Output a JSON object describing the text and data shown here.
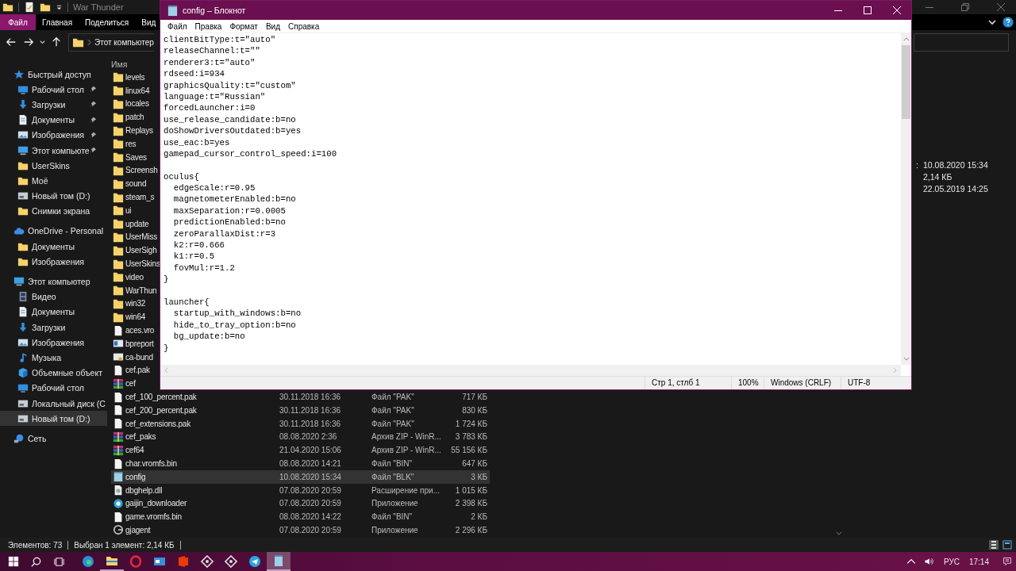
{
  "explorer": {
    "title": "War Thunder",
    "ribbon": [
      {
        "label": "Файл",
        "kind": "menu"
      },
      {
        "label": "Главная",
        "kind": "tab"
      },
      {
        "label": "Поделиться",
        "kind": "tab"
      },
      {
        "label": "Вид",
        "kind": "tab"
      }
    ],
    "address": {
      "crumbs": [
        "Этот компьютер"
      ]
    },
    "nav": [
      {
        "label": "Быстрый доступ",
        "kind": "star",
        "pinned": false,
        "selected": false,
        "children": [
          {
            "label": "Рабочий стол",
            "kind": "desktop",
            "pinned": true,
            "selected": false
          },
          {
            "label": "Загрузки",
            "kind": "download",
            "pinned": true,
            "selected": false
          },
          {
            "label": "Документы",
            "kind": "document",
            "pinned": true,
            "selected": false
          },
          {
            "label": "Изображения",
            "kind": "pictures",
            "pinned": true,
            "selected": false
          },
          {
            "label": "Этот компьюте",
            "kind": "computer",
            "pinned": true,
            "selected": false
          },
          {
            "label": "UserSkins",
            "kind": "folder",
            "pinned": false,
            "selected": false
          },
          {
            "label": "Моё",
            "kind": "folder",
            "pinned": false,
            "selected": false
          },
          {
            "label": "Новый том (D:)",
            "kind": "drive",
            "pinned": false,
            "selected": false
          },
          {
            "label": "Снимки экрана",
            "kind": "folder",
            "pinned": false,
            "selected": false
          }
        ]
      },
      {
        "label": "OneDrive - Personal",
        "kind": "cloud",
        "pinned": false,
        "selected": false,
        "children": [
          {
            "label": "Документы",
            "kind": "folder",
            "pinned": false,
            "selected": false
          },
          {
            "label": "Изображения",
            "kind": "folder",
            "pinned": false,
            "selected": false
          }
        ]
      },
      {
        "label": "Этот компьютер",
        "kind": "computer",
        "pinned": false,
        "selected": false,
        "children": [
          {
            "label": "Видео",
            "kind": "video",
            "pinned": false,
            "selected": false
          },
          {
            "label": "Документы",
            "kind": "document",
            "pinned": false,
            "selected": false
          },
          {
            "label": "Загрузки",
            "kind": "download",
            "pinned": false,
            "selected": false
          },
          {
            "label": "Изображения",
            "kind": "pictures",
            "pinned": false,
            "selected": false
          },
          {
            "label": "Музыка",
            "kind": "music",
            "pinned": false,
            "selected": false
          },
          {
            "label": "Объемные объект",
            "kind": "cube",
            "pinned": false,
            "selected": false
          },
          {
            "label": "Рабочий стол",
            "kind": "desktop",
            "pinned": false,
            "selected": false
          },
          {
            "label": "Локальный диск (С",
            "kind": "drive",
            "pinned": false,
            "selected": false
          },
          {
            "label": "Новый том (D:)",
            "kind": "drive",
            "pinned": false,
            "selected": true
          }
        ]
      },
      {
        "label": "Сеть",
        "kind": "network",
        "pinned": false,
        "selected": false
      }
    ],
    "file_list": {
      "column": "Имя",
      "rows": [
        {
          "name": "levels",
          "kind": "folder",
          "selected": false
        },
        {
          "name": "linux64",
          "kind": "folder",
          "selected": false
        },
        {
          "name": "locales",
          "kind": "folder",
          "selected": false
        },
        {
          "name": "patch",
          "kind": "folder",
          "selected": false
        },
        {
          "name": "Replays",
          "kind": "folder",
          "selected": false
        },
        {
          "name": "res",
          "kind": "folder",
          "selected": false
        },
        {
          "name": "Saves",
          "kind": "folder",
          "selected": false
        },
        {
          "name": "Screensh",
          "kind": "folder",
          "selected": false
        },
        {
          "name": "sound",
          "kind": "folder",
          "selected": false
        },
        {
          "name": "steam_s",
          "kind": "folder",
          "selected": false
        },
        {
          "name": "ui",
          "kind": "folder",
          "selected": false
        },
        {
          "name": "update",
          "kind": "folder",
          "selected": false
        },
        {
          "name": "UserMiss",
          "kind": "folder",
          "selected": false
        },
        {
          "name": "UserSigh",
          "kind": "folder",
          "selected": false
        },
        {
          "name": "UserSkins",
          "kind": "folder",
          "selected": false
        },
        {
          "name": "video",
          "kind": "folder",
          "selected": false
        },
        {
          "name": "WarThun",
          "kind": "folder",
          "selected": false
        },
        {
          "name": "win32",
          "kind": "folder",
          "selected": false
        },
        {
          "name": "win64",
          "kind": "folder",
          "selected": false
        },
        {
          "name": "aces.vro",
          "kind": "file",
          "selected": false
        },
        {
          "name": "bpreport",
          "kind": "app",
          "selected": false
        },
        {
          "name": "ca-bund",
          "kind": "cert",
          "selected": false
        },
        {
          "name": "cef.pak",
          "kind": "file",
          "selected": false
        },
        {
          "name": "cef",
          "kind": "archive",
          "selected": false
        },
        {
          "name": "cef_100_percent.pak",
          "kind": "file",
          "date": "30.11.2018 16:36",
          "type": "Файл \"PAK\"",
          "size": "717 КБ",
          "selected": false
        },
        {
          "name": "cef_200_percent.pak",
          "kind": "file",
          "date": "30.11.2018 16:36",
          "type": "Файл \"PAK\"",
          "size": "830 КБ",
          "selected": false
        },
        {
          "name": "cef_extensions.pak",
          "kind": "file",
          "date": "30.11.2018 16:36",
          "type": "Файл \"PAK\"",
          "size": "1 724 КБ",
          "selected": false
        },
        {
          "name": "cef_paks",
          "kind": "archive",
          "date": "08.08.2020 2:36",
          "type": "Архив ZIP - WinR...",
          "size": "3 783 КБ",
          "selected": false
        },
        {
          "name": "cef64",
          "kind": "archive",
          "date": "21.04.2020 15:06",
          "type": "Архив ZIP - WinR...",
          "size": "55 156 КБ",
          "selected": false
        },
        {
          "name": "char.vromfs.bin",
          "kind": "file",
          "date": "08.08.2020 14:21",
          "type": "Файл \"BIN\"",
          "size": "647 КБ",
          "selected": false
        },
        {
          "name": "config",
          "kind": "text",
          "date": "10.08.2020 15:34",
          "type": "Файл \"BLK\"",
          "size": "3 КБ",
          "selected": true
        },
        {
          "name": "dbghelp.dll",
          "kind": "dll",
          "date": "07.08.2020 20:59",
          "type": "Расширение при...",
          "size": "1 015 КБ",
          "selected": false
        },
        {
          "name": "gaijin_downloader",
          "kind": "gaijin",
          "date": "07.08.2020 20:59",
          "type": "Приложение",
          "size": "2 398 КБ",
          "selected": false
        },
        {
          "name": "game.vromfs.bin",
          "kind": "file",
          "date": "08.08.2020 14:22",
          "type": "Файл \"BIN\"",
          "size": "2 КБ",
          "selected": false
        },
        {
          "name": "gjagent",
          "kind": "agent",
          "date": "07.08.2020 20:59",
          "type": "Приложение",
          "size": "2 296 КБ",
          "selected": false
        }
      ]
    },
    "details": [
      {
        "label": ":",
        "value": "10.08.2020 15:34"
      },
      {
        "value": "2,14 КБ"
      },
      {
        "value": "22.05.2019 14:25"
      }
    ],
    "status": {
      "count": "Элементов: 73",
      "selection": "Выбран 1 элемент: 2,14 КБ"
    }
  },
  "notepad": {
    "title": "config – Блокнот",
    "menu": [
      "Файл",
      "Правка",
      "Формат",
      "Вид",
      "Справка"
    ],
    "lines": [
      {
        "text": "clientBitType:t=\"auto\""
      },
      {
        "text": "releaseChannel:t=\"\""
      },
      {
        "text": "renderer3:t=\"auto\""
      },
      {
        "text": "rdseed:i=934"
      },
      {
        "text": "graphicsQuality:t=\"custom\""
      },
      {
        "text": "language:t=\"Russian\""
      },
      {
        "text": "forcedLauncher:i=0"
      },
      {
        "text": "use_release_candidate:b=no"
      },
      {
        "text": "doShowDriversOutdated:b=yes"
      },
      {
        "text": "use_eac:b=yes"
      },
      {
        "text": "gamepad_cursor_control_speed:i=100"
      },
      {
        "text": "oculus{",
        "gap_before": true
      },
      {
        "text": "  edgeScale:r=0.95"
      },
      {
        "text": "  magnetometerEnabled:b=no"
      },
      {
        "text": "  maxSeparation:r=0.0005"
      },
      {
        "text": "  predictionEnabled:b=no"
      },
      {
        "text": "  zeroParallaxDist:r=3"
      },
      {
        "text": "  k2:r=0.666"
      },
      {
        "text": "  k1:r=0.5"
      },
      {
        "text": "  fovMul:r=1.2"
      },
      {
        "text": "}"
      },
      {
        "text": "launcher{",
        "gap_before": true
      },
      {
        "text": "  startup_with_windows:b=no"
      },
      {
        "text": "  hide_to_tray_option:b=no"
      },
      {
        "text": "  bg_update:b=no"
      },
      {
        "text": "}"
      }
    ],
    "status": {
      "position": "Стр 1, стлб 1",
      "zoom": "100%",
      "line_ending": "Windows (CRLF)",
      "encoding": "UTF-8"
    }
  },
  "taskbar": {
    "apps": [
      {
        "kind": "edge",
        "running": false,
        "active": false
      },
      {
        "kind": "explorer",
        "running": true,
        "active": false
      },
      {
        "kind": "opera",
        "running": false,
        "active": false
      },
      {
        "kind": "card",
        "running": false,
        "active": false
      },
      {
        "kind": "office",
        "running": false,
        "active": false
      },
      {
        "kind": "gear",
        "running": false,
        "active": false
      },
      {
        "kind": "gear",
        "running": false,
        "active": false
      },
      {
        "kind": "telegram",
        "running": false,
        "active": false
      },
      {
        "kind": "notepad",
        "running": true,
        "active": true
      }
    ],
    "language": "РУС",
    "time": "17:14"
  }
}
